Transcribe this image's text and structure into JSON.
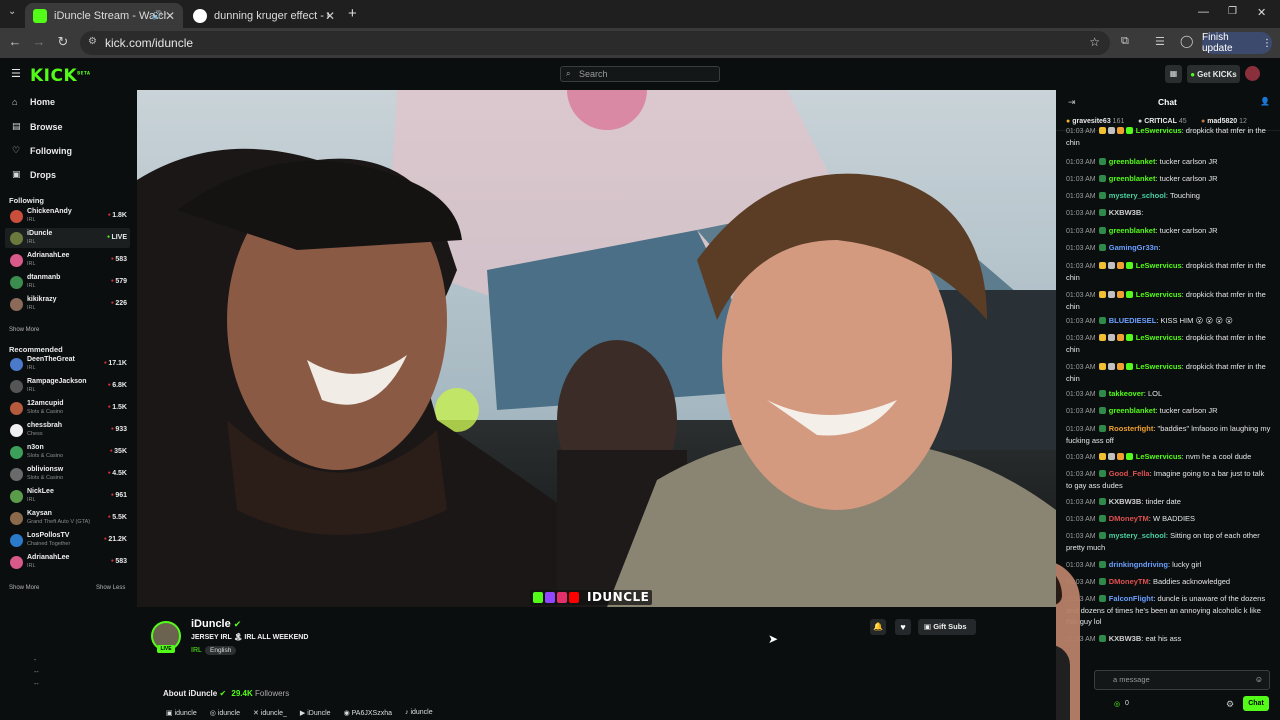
{
  "browser": {
    "tabs": [
      {
        "title": "iDuncle Stream - Watch Live",
        "active": true
      },
      {
        "title": "dunning kruger effect - Google",
        "active": false
      }
    ],
    "url": "kick.com/iduncle",
    "finish_update": "Finish update"
  },
  "header": {
    "logo": "KICK",
    "logo_tag": "BETA",
    "search_placeholder": "Search",
    "get_kicks": "Get KICKs"
  },
  "sidebar": {
    "nav": [
      "Home",
      "Browse",
      "Following",
      "Drops"
    ],
    "following_title": "Following",
    "following": [
      {
        "name": "ChickenAndy",
        "category": "IRL",
        "viewers": "1.8K",
        "color": "#c94f3c"
      },
      {
        "name": "iDuncle",
        "category": "IRL",
        "viewers": "LIVE",
        "color": "#6b7a3c"
      },
      {
        "name": "AdrianahLee",
        "category": "IRL",
        "viewers": "583",
        "color": "#d85a8a"
      },
      {
        "name": "dtanmanb",
        "category": "IRL",
        "viewers": "579",
        "color": "#3c8c4f"
      },
      {
        "name": "kikikrazy",
        "category": "IRL",
        "viewers": "226",
        "color": "#8c6a5a"
      }
    ],
    "show_more": "Show More",
    "recommended_title": "Recommended",
    "recommended": [
      {
        "name": "DeenTheGreat",
        "category": "IRL",
        "viewers": "17.1K",
        "color": "#4a7ac9"
      },
      {
        "name": "RampageJackson",
        "category": "IRL",
        "viewers": "6.8K",
        "color": "#555"
      },
      {
        "name": "12amcupid",
        "category": "Slots & Casino",
        "viewers": "1.5K",
        "color": "#b55a3c"
      },
      {
        "name": "chessbrah",
        "category": "Chess",
        "viewers": "933",
        "color": "#f0f0f0"
      },
      {
        "name": "n3on",
        "category": "Slots & Casino",
        "viewers": "35K",
        "color": "#3ca05a"
      },
      {
        "name": "oblivionsw",
        "category": "Slots & Casino",
        "viewers": "4.5K",
        "color": "#6a6a6a"
      },
      {
        "name": "NickLee",
        "category": "IRL",
        "viewers": "961",
        "color": "#5a9c4a"
      },
      {
        "name": "Kaysan",
        "category": "Grand Theft Auto V (GTA)",
        "viewers": "5.5K",
        "color": "#8a6a4a"
      },
      {
        "name": "LosPollosTV",
        "category": "Chained Together",
        "viewers": "21.2K",
        "color": "#2a7ac9"
      },
      {
        "name": "AdrianahLee",
        "category": "IRL",
        "viewers": "583",
        "color": "#d85a8a"
      }
    ],
    "show_less": "Show Less"
  },
  "video": {
    "watermark": "IDUNCLE"
  },
  "channel": {
    "name": "iDuncle",
    "title": "JERSEY IRL 🏝 IRL ALL WEEKEND",
    "category": "IRL",
    "language": "English",
    "live_badge": "LIVE",
    "gift_subs": "Gift Subs",
    "about": "About iDuncle",
    "followers_count": "29.4K",
    "followers_label": "Followers",
    "socials": [
      "iduncle",
      "iduncle",
      "iduncle_",
      "iDuncle",
      "PA6JXSzxha",
      "iduncle"
    ]
  },
  "chat": {
    "title": "Chat",
    "top_gifters": [
      {
        "name": "gravesite63",
        "count": "161"
      },
      {
        "name": "CRITICAL",
        "count": "45"
      },
      {
        "name": "mad5820",
        "count": "12"
      }
    ],
    "messages": [
      {
        "time": "01:03 AM",
        "user": "LeSwervicus",
        "color": "#53fc18",
        "text": "dropkick that mfer in the chin"
      },
      {
        "time": "01:03 AM",
        "user": "greenblanket",
        "color": "#53fc18",
        "text": "tucker carlson JR"
      },
      {
        "time": "01:03 AM",
        "user": "greenblanket",
        "color": "#53fc18",
        "text": "tucker carlson JR"
      },
      {
        "time": "01:03 AM",
        "user": "mystery_school",
        "color": "#4ad0a0",
        "text": "Touching"
      },
      {
        "time": "01:03 AM",
        "user": "KXBW3B",
        "color": "#d0d0d0",
        "text": ""
      },
      {
        "time": "01:03 AM",
        "user": "greenblanket",
        "color": "#53fc18",
        "text": "tucker carlson JR"
      },
      {
        "time": "01:03 AM",
        "user": "GamingGr33n",
        "color": "#6aa0ff",
        "text": ""
      },
      {
        "time": "01:03 AM",
        "user": "LeSwervicus",
        "color": "#53fc18",
        "text": "dropkick that mfer in the chin"
      },
      {
        "time": "01:03 AM",
        "user": "LeSwervicus",
        "color": "#53fc18",
        "text": "dropkick that mfer in the chin"
      },
      {
        "time": "01:03 AM",
        "user": "BLUEDIESEL",
        "color": "#6aa0ff",
        "text": "KISS HIM 😮 😮 😮 😮"
      },
      {
        "time": "01:03 AM",
        "user": "LeSwervicus",
        "color": "#53fc18",
        "text": "dropkick that mfer in the chin"
      },
      {
        "time": "01:03 AM",
        "user": "LeSwervicus",
        "color": "#53fc18",
        "text": "dropkick that mfer in the chin"
      },
      {
        "time": "01:03 AM",
        "user": "takkeover",
        "color": "#53fc18",
        "text": "LOL"
      },
      {
        "time": "01:03 AM",
        "user": "greenblanket",
        "color": "#53fc18",
        "text": "tucker carlson JR"
      },
      {
        "time": "01:03 AM",
        "user": "Roosterfight",
        "color": "#f0a030",
        "text": "\"baddies\" lmfaooo im laughing my fucking ass off"
      },
      {
        "time": "01:03 AM",
        "user": "LeSwervicus",
        "color": "#53fc18",
        "text": "nvm he a cool dude"
      },
      {
        "time": "01:03 AM",
        "user": "Good_Fella",
        "color": "#e05050",
        "text": "Imagine going to a bar just to talk to gay ass dudes"
      },
      {
        "time": "01:03 AM",
        "user": "KXBW3B",
        "color": "#d0d0d0",
        "text": "tinder date"
      },
      {
        "time": "01:03 AM",
        "user": "DMoneyTM",
        "color": "#e05050",
        "text": "W BADDIES"
      },
      {
        "time": "01:03 AM",
        "user": "mystery_school",
        "color": "#4ad0a0",
        "text": "Sitting on top of each other pretty much"
      },
      {
        "time": "01:03 AM",
        "user": "drinkingndriving",
        "color": "#6aa0ff",
        "text": "lucky girl"
      },
      {
        "time": "01:03 AM",
        "user": "DMoneyTM",
        "color": "#e05050",
        "text": "Baddies acknowledged"
      },
      {
        "time": "01:03 AM",
        "user": "FalconFlight",
        "color": "#6aa0ff",
        "text": "duncle is unaware of the dozens and dozens of times he's been an annoying alcoholic k like this guy lol"
      },
      {
        "time": "01:03 AM",
        "user": "KXBW3B",
        "color": "#d0d0d0",
        "text": "eat his ass"
      }
    ],
    "input_placeholder": "a message",
    "points": "0",
    "send_label": "Chat"
  }
}
